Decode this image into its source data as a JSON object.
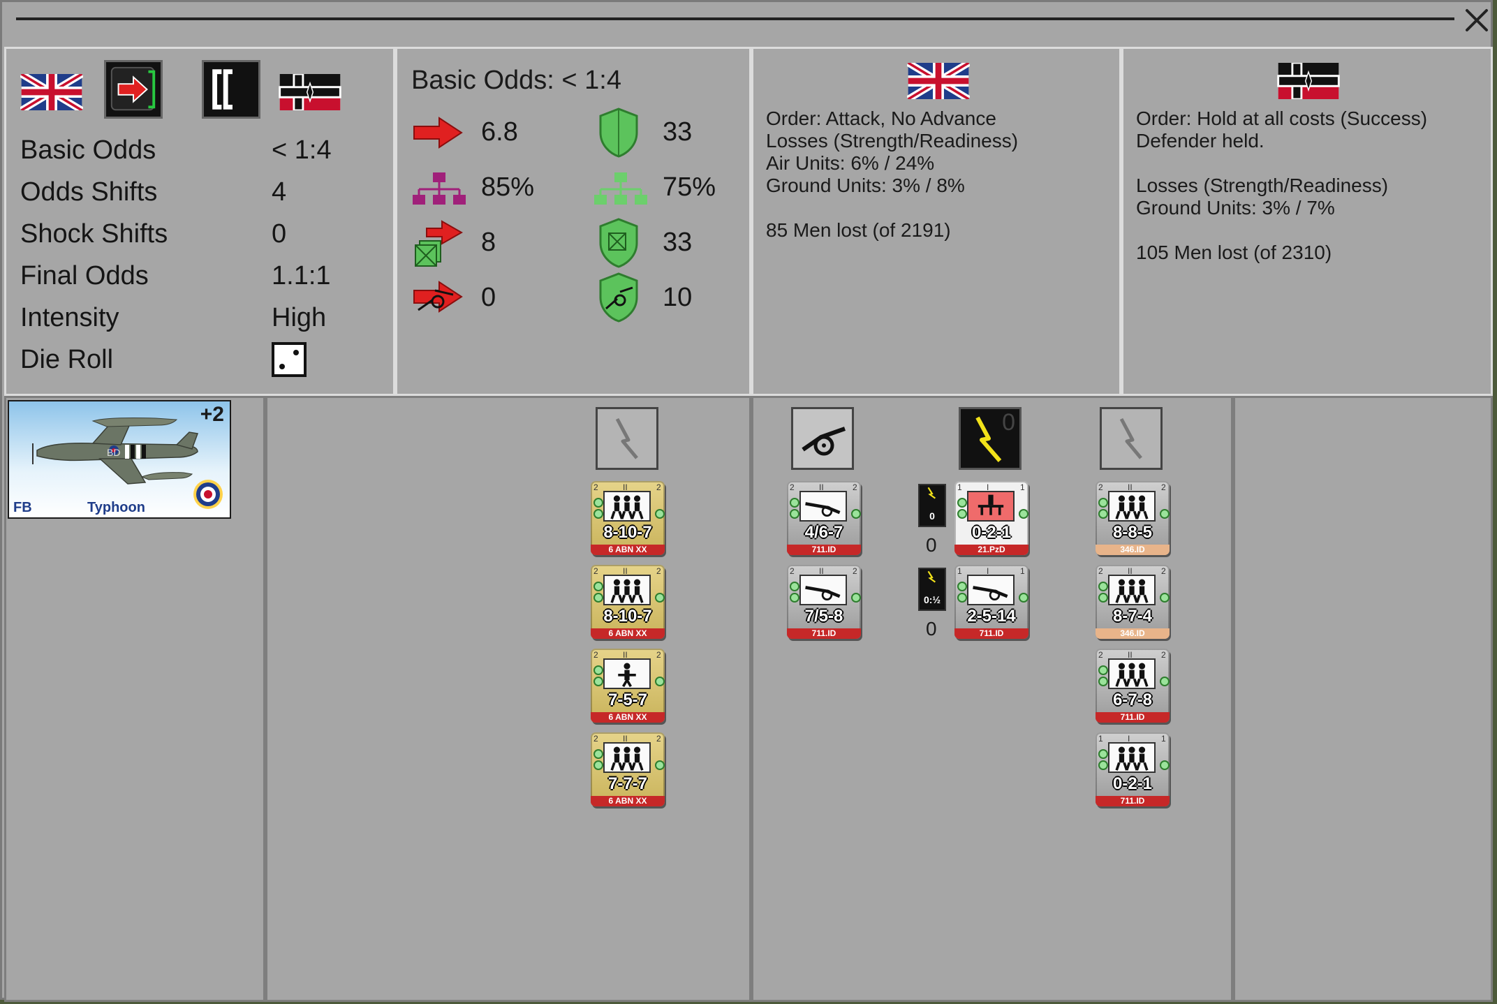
{
  "window": {
    "close_label": "close"
  },
  "summary": {
    "rows": [
      {
        "label": "Basic Odds",
        "value": "< 1:4"
      },
      {
        "label": "Odds Shifts",
        "value": "4"
      },
      {
        "label": "Shock Shifts",
        "value": "0"
      },
      {
        "label": "Final Odds",
        "value": "1.1:1"
      },
      {
        "label": "Intensity",
        "value": "High"
      },
      {
        "label": "Die Roll",
        "value": ""
      }
    ],
    "die_face": 2
  },
  "odds": {
    "heading": "Basic Odds: < 1:4",
    "attack_strength": "6.8",
    "defense_strength": "33",
    "attack_cohesion": "85%",
    "defense_cohesion": "75%",
    "attack_armor": "8",
    "defense_armor": "33",
    "attack_artillery": "0",
    "defense_artillery": "10"
  },
  "attacker": {
    "lines": [
      "Order: Attack, No Advance",
      "Losses (Strength/Readiness)",
      "Air Units: 6% / 24%",
      "Ground Units: 3% / 8%",
      "",
      "85 Men lost (of 2191)"
    ]
  },
  "defender": {
    "lines": [
      "Order: Hold at all costs (Success)",
      "Defender held.",
      "",
      "Losses (Strength/Readiness)",
      "Ground Units: 3% / 7%",
      "",
      "105 Men lost (of 2310)"
    ]
  },
  "air_unit": {
    "type": "FB",
    "name": "Typhoon",
    "modifier": "+2",
    "code": "BD"
  },
  "attacker_units": [
    {
      "strength": "8-10-7",
      "unit": "6 ABN XX",
      "size": "II",
      "corner": "2"
    },
    {
      "strength": "8-10-7",
      "unit": "6 ABN XX",
      "size": "II",
      "corner": "2"
    },
    {
      "strength": "7-5-7",
      "unit": "6 ABN XX",
      "size": "II",
      "corner": "2"
    },
    {
      "strength": "7-7-7",
      "unit": "6 ABN XX",
      "size": "II",
      "corner": "2"
    }
  ],
  "defender_artillery": [
    {
      "strength": "4/6-7",
      "unit": "711.ID",
      "size": "II",
      "corner": "2"
    },
    {
      "strength": "7/5-8",
      "unit": "711.ID",
      "size": "II",
      "corner": "2"
    }
  ],
  "defender_hq": [
    {
      "strength": "0-2-1",
      "unit": "21.PzD",
      "size": "I",
      "corner": "1",
      "badge": "0",
      "count": "0"
    },
    {
      "strength": "2-5-14",
      "unit": "711.ID",
      "size": "I",
      "corner": "1",
      "badge": "0:½",
      "count": "0"
    }
  ],
  "defender_hq_slot_digit": "0",
  "defender_infantry": [
    {
      "strength": "8-8-5",
      "unit": "346.ID",
      "size": "II",
      "corner": "2"
    },
    {
      "strength": "8-7-4",
      "unit": "346.ID",
      "size": "II",
      "corner": "2"
    },
    {
      "strength": "6-7-8",
      "unit": "711.ID",
      "size": "II",
      "corner": "2"
    },
    {
      "strength": "0-2-1",
      "unit": "711.ID",
      "size": "I",
      "corner": "1"
    }
  ],
  "colors": {
    "attack_red": "#e02020",
    "defense_green": "#4caf50",
    "cohesion_magenta": "#a0207a",
    "unit_red": "#c62828"
  }
}
